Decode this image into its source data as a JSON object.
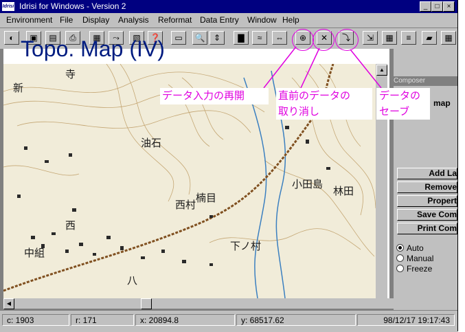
{
  "window": {
    "title": "Idrisi for Windows  -  Version 2",
    "icon_label": "Idrisi",
    "controls": [
      "_",
      "□",
      "×"
    ]
  },
  "menu": [
    "Environment",
    "File",
    "Display",
    "Analysis",
    "Reformat",
    "Data Entry",
    "Window",
    "Help"
  ],
  "toolbar": {
    "icons": [
      "globe-icon",
      "layers-icon",
      "list-icon",
      "printer-icon",
      "map-image-icon",
      "add-layer-icon",
      "palette-icon",
      "query-icon",
      "window-icon",
      "zoom-icon",
      "pan-icon",
      "histogram-icon",
      "waves-icon",
      "arrows-icon",
      "resume-entry-icon",
      "undo-icon",
      "save-entry-icon",
      "export-icon",
      "table-icon",
      "legend-icon",
      "eraser-icon",
      "grid-icon"
    ],
    "glyphs": [
      "◐",
      "▣",
      "▤",
      "⎙",
      "▦",
      "⤳",
      "▧",
      "❓",
      "▭",
      "🔍",
      "⇕",
      "▇",
      "≈",
      "⇔",
      "⊕",
      "✕",
      "⤵",
      "⇲",
      "▦",
      "≡",
      "▰",
      "▦"
    ]
  },
  "map": {
    "title": "Topo. Map (IV)"
  },
  "composer": {
    "title": "Composer",
    "partial_label": "map",
    "buttons": [
      "Add La",
      "Remove",
      "Propert",
      "Save Com",
      "Print Com"
    ],
    "radios": [
      {
        "label": "Auto",
        "checked": true
      },
      {
        "label": "Manual",
        "checked": false
      },
      {
        "label": "Freeze",
        "checked": false
      }
    ]
  },
  "status": {
    "c": "c:  1903",
    "r": "r:  171",
    "x": "x:  20894.8",
    "y": "y:  68517.62",
    "datetime": "98/12/17 19:17:43"
  },
  "annotations": {
    "resume": "データ入力の再開",
    "undo_line1": "直前のデータの",
    "undo_line2": "取り消し",
    "save_line1": "データの",
    "save_line1b": "セーブ"
  },
  "colors": {
    "titlebar": "#000080",
    "annotation": "#e000e0",
    "map_title": "#001c80"
  }
}
